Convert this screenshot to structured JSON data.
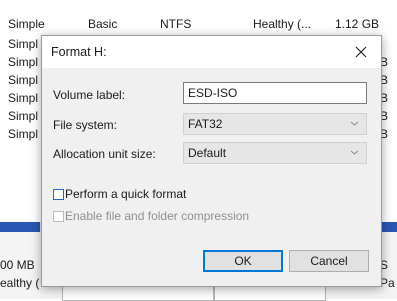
{
  "volume_list": {
    "first_row": {
      "layout": "Simple",
      "type": "Basic",
      "file_system": "NTFS",
      "status": "Healthy (...",
      "capacity": "1.12 GB"
    },
    "other_rows_layout": [
      "Simpl",
      "Simpl",
      "Simpl",
      "Simpl",
      "Simpl",
      "Simpl"
    ],
    "right_fragments": [
      "B",
      "B",
      "B",
      "B",
      "B"
    ]
  },
  "disk_map": {
    "size_text": "00 MB",
    "status_text": "ealthy (",
    "right_letter": "S",
    "right_text": "Pa"
  },
  "dialog": {
    "title": "Format H:",
    "volume_label": {
      "label": "Volume label:",
      "value": "ESD-ISO"
    },
    "file_system": {
      "label": "File system:",
      "value": "FAT32"
    },
    "allocation": {
      "label": "Allocation unit size:",
      "value": "Default"
    },
    "quick_format": {
      "label": "Perform a quick format",
      "checked": false
    },
    "compression": {
      "label": "Enable file and folder compression",
      "checked": false,
      "enabled": false
    },
    "ok_label": "OK",
    "cancel_label": "Cancel"
  },
  "colors": {
    "accent": "#0078d7",
    "disk_bar": "#2a57b3",
    "checkbox_blue": "#1f6ac7"
  }
}
